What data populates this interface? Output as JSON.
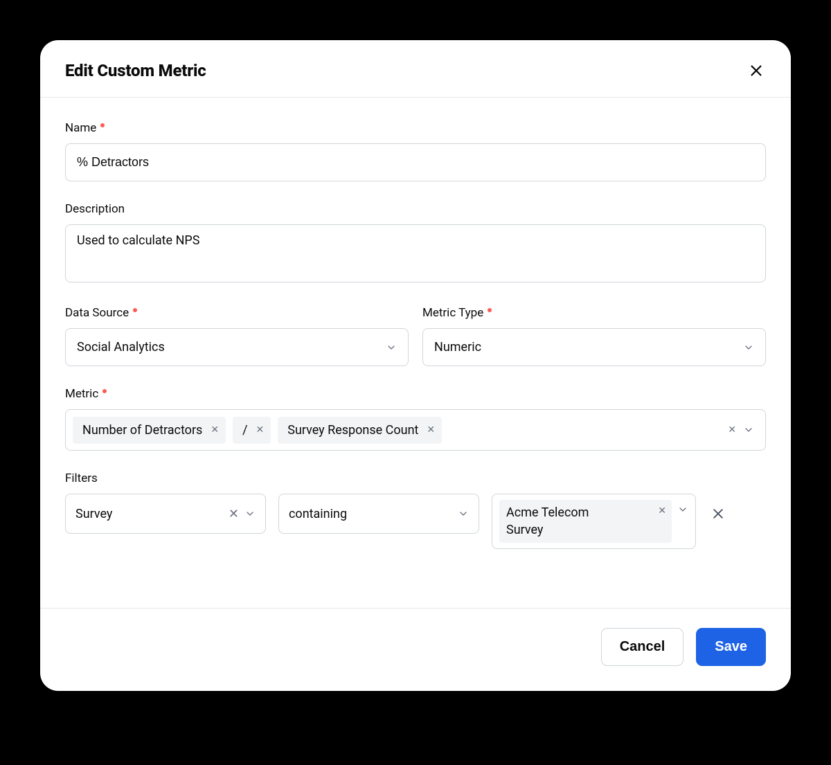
{
  "dialog": {
    "title": "Edit Custom Metric",
    "labels": {
      "name": "Name",
      "description": "Description",
      "dataSource": "Data Source",
      "metricType": "Metric Type",
      "metric": "Metric",
      "filters": "Filters"
    },
    "values": {
      "name": "% Detractors",
      "description": "Used to calculate NPS",
      "dataSource": "Social Analytics",
      "metricType": "Numeric"
    },
    "metricExpression": {
      "tokens": [
        {
          "label": "Number of Detractors"
        },
        {
          "label": "/"
        },
        {
          "label": "Survey Response Count"
        }
      ]
    },
    "filters": [
      {
        "field": "Survey",
        "operator": "containing",
        "values": [
          "Acme Telecom",
          "Survey"
        ]
      }
    ],
    "buttons": {
      "cancel": "Cancel",
      "save": "Save"
    }
  }
}
